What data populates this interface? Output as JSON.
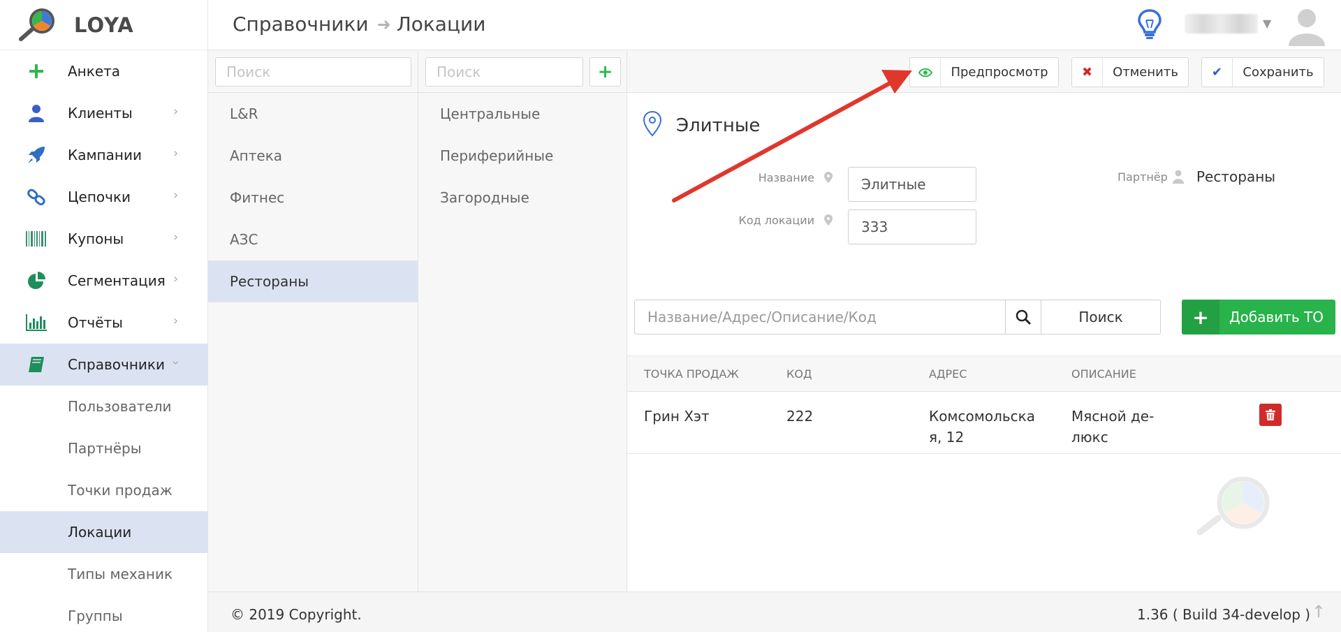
{
  "app": {
    "logo_text": "LOYA"
  },
  "sidebar": {
    "items": [
      {
        "label": "Анкета",
        "icon": "plus-icon",
        "has_chevron": false
      },
      {
        "label": "Клиенты",
        "icon": "user-icon",
        "has_chevron": true
      },
      {
        "label": "Кампании",
        "icon": "rocket-icon",
        "has_chevron": true
      },
      {
        "label": "Цепочки",
        "icon": "chain-link-icon",
        "has_chevron": true
      },
      {
        "label": "Купоны",
        "icon": "barcode-icon",
        "has_chevron": true
      },
      {
        "label": "Сегментация",
        "icon": "pie-chart-icon",
        "has_chevron": true
      },
      {
        "label": "Отчёты",
        "icon": "bar-chart-icon",
        "has_chevron": true
      },
      {
        "label": "Справочники",
        "icon": "book-icon",
        "has_chevron": true,
        "expanded": true,
        "active": true
      }
    ],
    "sub_items": [
      {
        "label": "Пользователи"
      },
      {
        "label": "Партнёры"
      },
      {
        "label": "Точки продаж"
      },
      {
        "label": "Локации",
        "active": true
      },
      {
        "label": "Типы механик"
      },
      {
        "label": "Группы"
      }
    ]
  },
  "header": {
    "breadcrumb": {
      "parent": "Справочники",
      "current": "Локации"
    }
  },
  "partners_column": {
    "search_placeholder": "Поиск",
    "items": [
      "L&R",
      "Аптека",
      "Фитнес",
      "АЗС",
      "Рестораны"
    ],
    "selected": "Рестораны"
  },
  "groups_column": {
    "search_placeholder": "Поиск",
    "items": [
      "Центральные",
      "Периферийные",
      "Загородные"
    ]
  },
  "toolbar": {
    "preview_label": "Предпросмотр",
    "cancel_label": "Отменить",
    "save_label": "Сохранить"
  },
  "location": {
    "title": "Элитные",
    "name_label": "Название",
    "name_value": "Элитные",
    "code_label": "Код локации",
    "code_value": "333",
    "partner_label": "Партнёр",
    "partner_value": "Рестораны"
  },
  "search": {
    "placeholder": "Название/Адрес/Описание/Код",
    "button_label": "Поиск",
    "add_label": "Добавить ТО"
  },
  "table": {
    "columns": [
      "ТОЧКА ПРОДАЖ",
      "КОД",
      "АДРЕС",
      "ОПИСАНИЕ"
    ],
    "rows": [
      {
        "point": "Грин Хэт",
        "code": "222",
        "address_line1": "Комсомольска",
        "address_line2": "я, 12",
        "description_line1": "Мясной де-",
        "description_line2": "люкс"
      }
    ]
  },
  "footer": {
    "copyright": "© 2019 Copyright.",
    "version": "1.36 ( Build 34-develop )"
  },
  "colors": {
    "accent_green": "#28b34b",
    "active_bg": "#dbe3f3",
    "danger": "#d12a2a",
    "annotation_arrow": "#e0372c"
  }
}
